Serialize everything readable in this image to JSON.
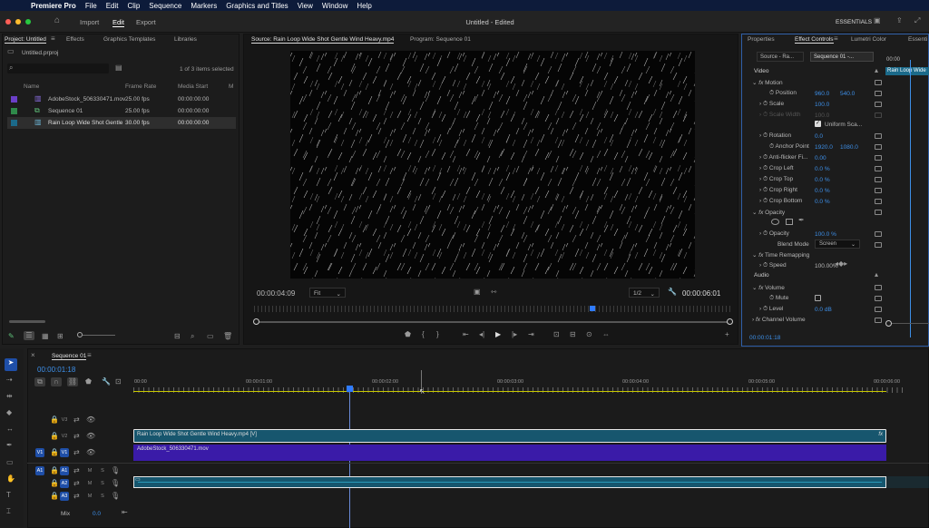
{
  "menubar": {
    "app": "Premiere Pro",
    "items": [
      "File",
      "Edit",
      "Clip",
      "Sequence",
      "Markers",
      "Graphics and Titles",
      "View",
      "Window",
      "Help"
    ]
  },
  "appbar": {
    "import": "Import",
    "edit": "Edit",
    "export": "Export",
    "title": "Untitled - Edited",
    "workspace": "ESSENTIALS"
  },
  "project": {
    "tab": "Project: Untitled",
    "tabs": [
      "Effects",
      "Graphics Templates",
      "Libraries"
    ],
    "file": "Untitled.prproj",
    "count": "1 of 3 items selected",
    "cols": [
      "Name",
      "Frame Rate",
      "Media Start",
      "M"
    ],
    "items": [
      {
        "name": "AdobeStock_506330471.mov",
        "fps": "25.00 fps",
        "start": "00:00:00:00",
        "color": "#6b3fc8"
      },
      {
        "name": "Sequence 01",
        "fps": "25.00 fps",
        "start": "00:00:00:00",
        "color": "#2f8a4a"
      },
      {
        "name": "Rain Loop Wide Shot Gentle",
        "fps": "30.00 fps",
        "start": "00:00:00:00",
        "color": "#1b6a8a"
      }
    ]
  },
  "source": {
    "tab": "Source: Rain Loop Wide Shot Gentle Wind Heavy.mp4",
    "tab2": "Program: Sequence 01",
    "timecode": "00:00:04:09",
    "fit": "Fit",
    "res": "1/2",
    "duration": "00:00:06:01"
  },
  "effects": {
    "tabs": [
      "Properties",
      "Effect Controls",
      "Lumetri Color",
      "Essenti"
    ],
    "source": "Source - Ra...",
    "seq": "Sequence 01 -...",
    "clip": "Rain Loop Wide",
    "time": "00:00",
    "video": "Video",
    "motion": "Motion",
    "position_label": "Position",
    "position_x": "960.0",
    "position_y": "540.0",
    "scale_label": "Scale",
    "scale": "100.0",
    "scalew_label": "Scale Width",
    "scalew": "100.0",
    "uniform": "Uniform Sca...",
    "rotation_label": "Rotation",
    "rotation": "0.0",
    "anchor_label": "Anchor Point",
    "anchor_x": "1920.0",
    "anchor_y": "1080.0",
    "flicker_label": "Anti-flicker Fi...",
    "flicker": "0.00",
    "crops": [
      {
        "label": "Crop Left",
        "value": "0.0 %"
      },
      {
        "label": "Crop Top",
        "value": "0.0 %"
      },
      {
        "label": "Crop Right",
        "value": "0.0 %"
      },
      {
        "label": "Crop Bottom",
        "value": "0.0 %"
      }
    ],
    "opacity": "Opacity",
    "opacity_label": "Opacity",
    "opacity_value": "100.0 %",
    "blend_label": "Blend Mode",
    "blend": "Screen",
    "time_remap": "Time Remapping",
    "speed_label": "Speed",
    "speed": "100.00%",
    "audio": "Audio",
    "volume": "Volume",
    "mute": "Mute",
    "level_label": "Level",
    "level": "0.0 dB",
    "channel": "Channel Volume",
    "bottom_time": "00:00:01:18"
  },
  "timeline": {
    "tab": "Sequence 01",
    "timecode": "00:00:01:18",
    "ruler": [
      "00:00",
      "00:00:01:00",
      "00:00:02:00",
      "00:00:03:00",
      "00:00:04:00",
      "00:00:05:00",
      "00:00:06:00"
    ],
    "clip_v2": "Rain Loop Wide Shot Gentle Wind Heavy.mp4 [V]",
    "clip_v1": "AdobeStock_506330471.mov",
    "fx": "fx",
    "vtracks": [
      "V3",
      "V2",
      "V1"
    ],
    "atracks": [
      "A1",
      "A2",
      "A3"
    ],
    "mix": "Mix",
    "mix_value": "0.0",
    "v1src": "V1",
    "a1src": "A1",
    "m": "M",
    "s": "S"
  }
}
